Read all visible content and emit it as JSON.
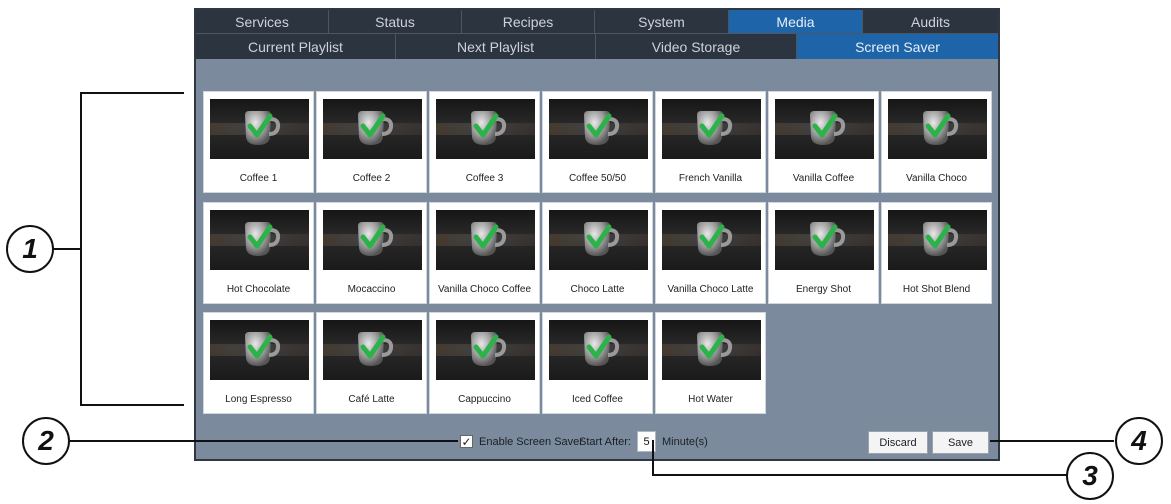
{
  "tabs": [
    {
      "label": "Services",
      "active": false
    },
    {
      "label": "Status",
      "active": false
    },
    {
      "label": "Recipes",
      "active": false
    },
    {
      "label": "System",
      "active": false
    },
    {
      "label": "Media",
      "active": true
    },
    {
      "label": "Audits",
      "active": false
    }
  ],
  "subtabs": [
    {
      "label": "Current Playlist",
      "active": false
    },
    {
      "label": "Next Playlist",
      "active": false
    },
    {
      "label": "Video Storage",
      "active": false
    },
    {
      "label": "Screen Saver",
      "active": true
    }
  ],
  "items": [
    {
      "label": "Coffee 1"
    },
    {
      "label": "Coffee 2"
    },
    {
      "label": "Coffee 3"
    },
    {
      "label": "Coffee 50/50"
    },
    {
      "label": "French Vanilla"
    },
    {
      "label": "Vanilla Coffee"
    },
    {
      "label": "Vanilla Choco"
    },
    {
      "label": "Hot Chocolate"
    },
    {
      "label": "Mocaccino"
    },
    {
      "label": "Vanilla Choco Coffee"
    },
    {
      "label": "Choco Latte"
    },
    {
      "label": "Vanilla Choco Latte"
    },
    {
      "label": "Energy Shot"
    },
    {
      "label": "Hot Shot Blend"
    },
    {
      "label": "Long Espresso"
    },
    {
      "label": "Café Latte"
    },
    {
      "label": "Cappuccino"
    },
    {
      "label": "Iced Coffee"
    },
    {
      "label": "Hot Water"
    }
  ],
  "bottom": {
    "enable_checked": true,
    "check_glyph": "✓",
    "enable_label": "Enable Screen Saver",
    "start_label": "Start After:",
    "minutes_value": "5",
    "minutes_label": "Minute(s)",
    "discard_label": "Discard",
    "save_label": "Save"
  },
  "callouts": [
    "1",
    "2",
    "3",
    "4"
  ],
  "colors": {
    "tab_bg": "#2c3440",
    "tab_active": "#1d64a8",
    "screen_bg": "#7b8a9d",
    "check_green": "#2bb34a"
  }
}
